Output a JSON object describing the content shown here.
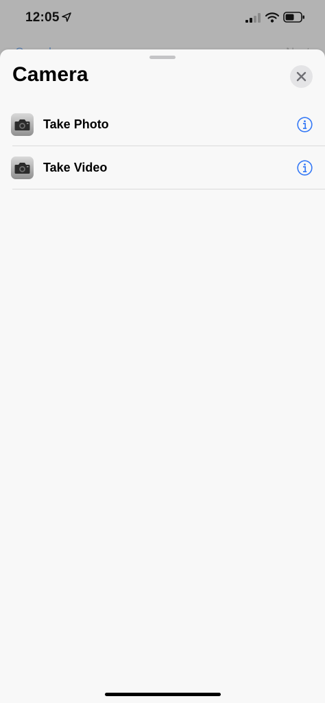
{
  "status_bar": {
    "time": "12:05",
    "icons": [
      "location-arrow-icon",
      "cellular-signal-icon",
      "wifi-icon",
      "battery-icon"
    ]
  },
  "background_screen": {
    "cancel_label": "Cancel",
    "next_label": "Next"
  },
  "sheet": {
    "title": "Camera",
    "close_icon": "close-icon",
    "actions": [
      {
        "label": "Take Photo",
        "icon": "camera-icon",
        "info_icon": "info-icon"
      },
      {
        "label": "Take Video",
        "icon": "camera-icon",
        "info_icon": "info-icon"
      }
    ]
  },
  "colors": {
    "accent": "#3478f6",
    "sheet_background": "#f8f8f8",
    "dimmed_background": "#b3b3b3",
    "divider": "#dadada"
  }
}
